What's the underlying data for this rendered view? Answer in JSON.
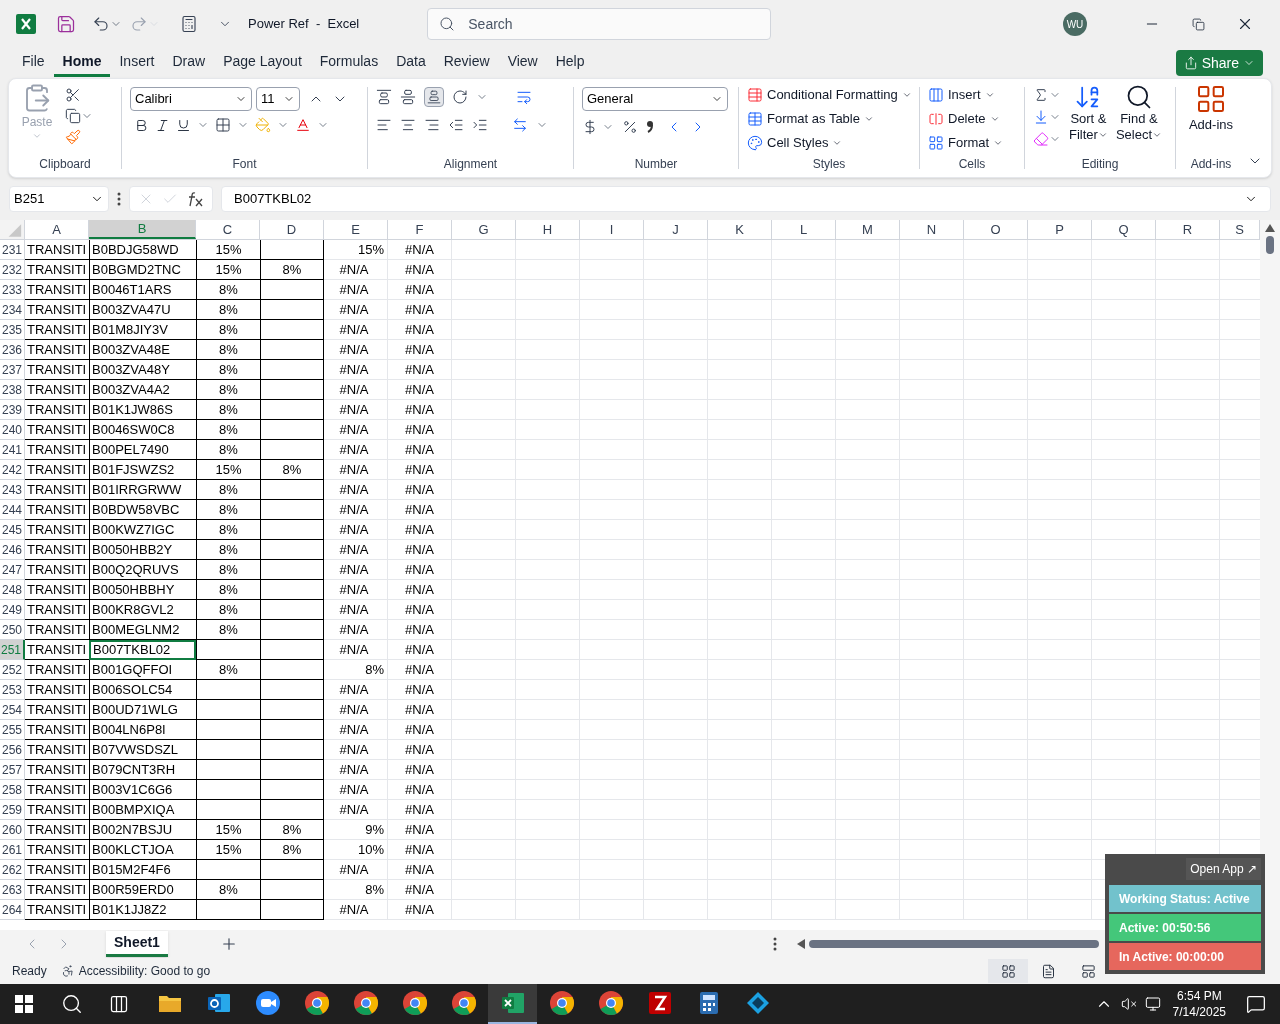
{
  "title_bar": {
    "title": "Power Ref  -  Excel",
    "search_placeholder": "Search",
    "avatar": "WU"
  },
  "menu_tabs": [
    {
      "label": "File",
      "selected": false
    },
    {
      "label": "Home",
      "selected": true
    },
    {
      "label": "Insert",
      "selected": false
    },
    {
      "label": "Draw",
      "selected": false
    },
    {
      "label": "Page Layout",
      "selected": false
    },
    {
      "label": "Formulas",
      "selected": false
    },
    {
      "label": "Data",
      "selected": false
    },
    {
      "label": "Review",
      "selected": false
    },
    {
      "label": "View",
      "selected": false
    },
    {
      "label": "Help",
      "selected": false
    }
  ],
  "share": "Share",
  "ribbon": {
    "paste": "Paste",
    "clipboard_label": "Clipboard",
    "font_name": "Calibri",
    "font_size": "11",
    "font_label": "Font",
    "alignment_label": "Alignment",
    "number_format": "General",
    "number_label": "Number",
    "styles": [
      "Conditional Formatting",
      "Format as Table",
      "Cell Styles"
    ],
    "styles_label": "Styles",
    "cells": [
      "Insert",
      "Delete",
      "Format"
    ],
    "cells_label": "Cells",
    "editing": [
      {
        "line1": "Sort &",
        "line2": "Filter"
      },
      {
        "line1": "Find &",
        "line2": "Select"
      }
    ],
    "editing_label": "Editing",
    "addins": "Add-ins",
    "addins_label": "Add-ins"
  },
  "formula_bar": {
    "name_box": "B251",
    "formula": "B007TKBL02"
  },
  "columns": [
    {
      "label": "A",
      "selected": false
    },
    {
      "label": "B",
      "selected": true
    },
    {
      "label": "C",
      "selected": false
    },
    {
      "label": "D",
      "selected": false
    },
    {
      "label": "E",
      "selected": false
    },
    {
      "label": "F",
      "selected": false
    },
    {
      "label": "G",
      "selected": false
    },
    {
      "label": "H",
      "selected": false
    },
    {
      "label": "I",
      "selected": false
    },
    {
      "label": "J",
      "selected": false
    },
    {
      "label": "K",
      "selected": false
    },
    {
      "label": "L",
      "selected": false
    },
    {
      "label": "M",
      "selected": false
    },
    {
      "label": "N",
      "selected": false
    },
    {
      "label": "O",
      "selected": false
    },
    {
      "label": "P",
      "selected": false
    },
    {
      "label": "Q",
      "selected": false
    },
    {
      "label": "R",
      "selected": false
    },
    {
      "label": "S",
      "selected": false
    }
  ],
  "rows": [
    {
      "number": "231",
      "selected": false,
      "a": "TRANSITI",
      "b": "B0BDJG58WD",
      "c": "15%",
      "e": "15%",
      "e_numeric": true,
      "f": "#N/A"
    },
    {
      "number": "232",
      "selected": false,
      "a": "TRANSITI",
      "b": "B0BGMD2TNC",
      "c": "15%",
      "d": "8%",
      "e": "#N/A",
      "e_numeric": false,
      "f": "#N/A"
    },
    {
      "number": "233",
      "selected": false,
      "a": "TRANSITI",
      "b": "B0046T1ARS",
      "c": "8%",
      "e": "#N/A",
      "e_numeric": false,
      "f": "#N/A"
    },
    {
      "number": "234",
      "selected": false,
      "a": "TRANSITI",
      "b": "B003ZVA47U",
      "c": "8%",
      "e": "#N/A",
      "e_numeric": false,
      "f": "#N/A"
    },
    {
      "number": "235",
      "selected": false,
      "a": "TRANSITI",
      "b": "B01M8JIY3V",
      "c": "8%",
      "e": "#N/A",
      "e_numeric": false,
      "f": "#N/A"
    },
    {
      "number": "236",
      "selected": false,
      "a": "TRANSITI",
      "b": "B003ZVA48E",
      "c": "8%",
      "e": "#N/A",
      "e_numeric": false,
      "f": "#N/A"
    },
    {
      "number": "237",
      "selected": false,
      "a": "TRANSITI",
      "b": "B003ZVA48Y",
      "c": "8%",
      "e": "#N/A",
      "e_numeric": false,
      "f": "#N/A"
    },
    {
      "number": "238",
      "selected": false,
      "a": "TRANSITI",
      "b": "B003ZVA4A2",
      "c": "8%",
      "e": "#N/A",
      "e_numeric": false,
      "f": "#N/A"
    },
    {
      "number": "239",
      "selected": false,
      "a": "TRANSITI",
      "b": "B01K1JW86S",
      "c": "8%",
      "e": "#N/A",
      "e_numeric": false,
      "f": "#N/A"
    },
    {
      "number": "240",
      "selected": false,
      "a": "TRANSITI",
      "b": "B0046SW0C8",
      "c": "8%",
      "e": "#N/A",
      "e_numeric": false,
      "f": "#N/A"
    },
    {
      "number": "241",
      "selected": false,
      "a": "TRANSITI",
      "b": "B00PEL7490",
      "c": "8%",
      "e": "#N/A",
      "e_numeric": false,
      "f": "#N/A"
    },
    {
      "number": "242",
      "selected": false,
      "a": "TRANSITI",
      "b": "B01FJSWZS2",
      "c": "15%",
      "d": "8%",
      "e": "#N/A",
      "e_numeric": false,
      "f": "#N/A"
    },
    {
      "number": "243",
      "selected": false,
      "a": "TRANSITI",
      "b": "B01IRRGRWW",
      "c": "8%",
      "e": "#N/A",
      "e_numeric": false,
      "f": "#N/A"
    },
    {
      "number": "244",
      "selected": false,
      "a": "TRANSITI",
      "b": "B0BDW58VBC",
      "c": "8%",
      "e": "#N/A",
      "e_numeric": false,
      "f": "#N/A"
    },
    {
      "number": "245",
      "selected": false,
      "a": "TRANSITI",
      "b": "B00KWZ7IGC",
      "c": "8%",
      "e": "#N/A",
      "e_numeric": false,
      "f": "#N/A"
    },
    {
      "number": "246",
      "selected": false,
      "a": "TRANSITI",
      "b": "B0050HBB2Y",
      "c": "8%",
      "e": "#N/A",
      "e_numeric": false,
      "f": "#N/A"
    },
    {
      "number": "247",
      "selected": false,
      "a": "TRANSITI",
      "b": "B00Q2QRUVS",
      "c": "8%",
      "e": "#N/A",
      "e_numeric": false,
      "f": "#N/A"
    },
    {
      "number": "248",
      "selected": false,
      "a": "TRANSITI",
      "b": "B0050HBBHY",
      "c": "8%",
      "e": "#N/A",
      "e_numeric": false,
      "f": "#N/A"
    },
    {
      "number": "249",
      "selected": false,
      "a": "TRANSITI",
      "b": "B00KR8GVL2",
      "c": "8%",
      "e": "#N/A",
      "e_numeric": false,
      "f": "#N/A"
    },
    {
      "number": "250",
      "selected": false,
      "a": "TRANSITI",
      "b": "B00MEGLNM2",
      "c": "8%",
      "e": "#N/A",
      "e_numeric": false,
      "f": "#N/A"
    },
    {
      "number": "251",
      "selected": true,
      "a": "TRANSITI",
      "b": "B007TKBL02",
      "e": "#N/A",
      "e_numeric": false,
      "f": "#N/A"
    },
    {
      "number": "252",
      "selected": false,
      "a": "TRANSITI",
      "b": "B001GQFFOI",
      "c": "8%",
      "e": "8%",
      "e_numeric": true,
      "f": "#N/A"
    },
    {
      "number": "253",
      "selected": false,
      "a": "TRANSITI",
      "b": "B006SOLC54",
      "e": "#N/A",
      "e_numeric": false,
      "f": "#N/A"
    },
    {
      "number": "254",
      "selected": false,
      "a": "TRANSITI",
      "b": "B00UD71WLG",
      "e": "#N/A",
      "e_numeric": false,
      "f": "#N/A"
    },
    {
      "number": "255",
      "selected": false,
      "a": "TRANSITI",
      "b": "B004LN6P8I",
      "e": "#N/A",
      "e_numeric": false,
      "f": "#N/A"
    },
    {
      "number": "256",
      "selected": false,
      "a": "TRANSITI",
      "b": "B07VWSDSZL",
      "e": "#N/A",
      "e_numeric": false,
      "f": "#N/A"
    },
    {
      "number": "257",
      "selected": false,
      "a": "TRANSITI",
      "b": "B079CNT3RH",
      "e": "#N/A",
      "e_numeric": false,
      "f": "#N/A"
    },
    {
      "number": "258",
      "selected": false,
      "a": "TRANSITI",
      "b": "B003V1C6G6",
      "e": "#N/A",
      "e_numeric": false,
      "f": "#N/A"
    },
    {
      "number": "259",
      "selected": false,
      "a": "TRANSITI",
      "b": "B00BMPXIQA",
      "e": "#N/A",
      "e_numeric": false,
      "f": "#N/A"
    },
    {
      "number": "260",
      "selected": false,
      "a": "TRANSITI",
      "b": "B002N7BSJU",
      "c": "15%",
      "d": "8%",
      "e": "9%",
      "e_numeric": true,
      "f": "#N/A"
    },
    {
      "number": "261",
      "selected": false,
      "a": "TRANSITI",
      "b": "B00KLCTJOA",
      "c": "15%",
      "d": "8%",
      "e": "10%",
      "e_numeric": true,
      "f": "#N/A"
    },
    {
      "number": "262",
      "selected": false,
      "a": "TRANSITI",
      "b": "B015M2F4F6",
      "e": "#N/A",
      "e_numeric": false,
      "f": "#N/A"
    },
    {
      "number": "263",
      "selected": false,
      "a": "TRANSITI",
      "b": "B00R59ERD0",
      "c": "8%",
      "e": "8%",
      "e_numeric": true,
      "f": "#N/A"
    },
    {
      "number": "264",
      "selected": false,
      "a": "TRANSITI",
      "b": "B01K1JJ8Z2",
      "e": "#N/A",
      "e_numeric": false,
      "f": "#N/A"
    }
  ],
  "sheet_tabs": [
    {
      "label": "Sheet1",
      "selected": true
    }
  ],
  "status_bar": {
    "ready": "Ready",
    "accessibility": "Accessibility: Good to go",
    "views": [
      {
        "kind": "normal",
        "selected": true
      },
      {
        "kind": "page-layout",
        "selected": false
      },
      {
        "kind": "page-break",
        "selected": false
      }
    ]
  },
  "tracker": {
    "open_app": "Open App ↗",
    "status": "Working Status: Active",
    "active": "Active: 00:50:56",
    "inactive": "In Active: 00:00:00"
  },
  "taskbar": {
    "apps": [
      {
        "kind": "explorer",
        "selected": false
      },
      {
        "kind": "outlook",
        "selected": false
      },
      {
        "kind": "zoom",
        "selected": false
      },
      {
        "kind": "chrome",
        "selected": false
      },
      {
        "kind": "chrome",
        "selected": false
      },
      {
        "kind": "chrome",
        "selected": false
      },
      {
        "kind": "chrome",
        "selected": false
      },
      {
        "kind": "excel",
        "selected": true
      },
      {
        "kind": "chrome",
        "selected": false
      },
      {
        "kind": "chrome",
        "selected": false
      },
      {
        "kind": "filezilla",
        "selected": false
      },
      {
        "kind": "calculator",
        "selected": false
      },
      {
        "kind": "diamond",
        "selected": false
      }
    ],
    "time": "6:54 PM",
    "date": "7/14/2025"
  }
}
